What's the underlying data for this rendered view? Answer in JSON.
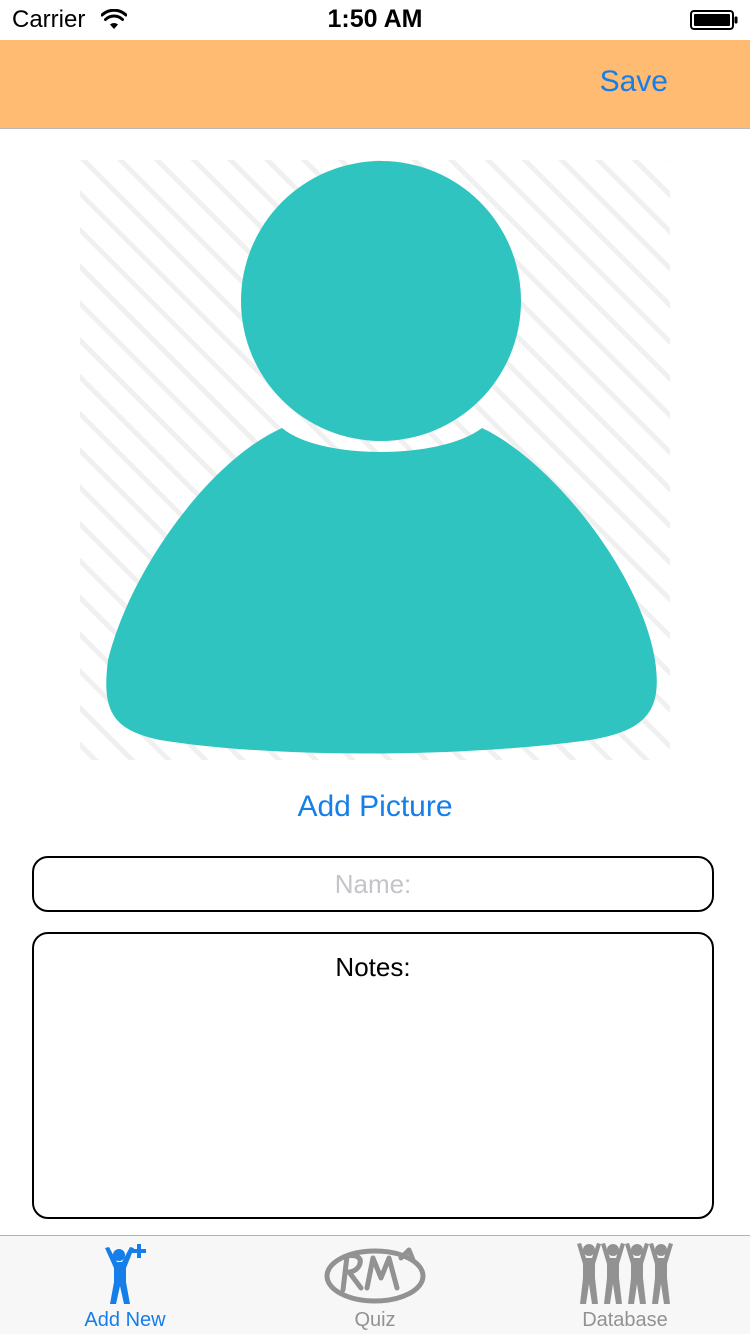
{
  "status_bar": {
    "carrier": "Carrier",
    "time": "1:50 AM"
  },
  "nav": {
    "save_label": "Save"
  },
  "colors": {
    "nav_background": "#FEBB71",
    "accent": "#157EE8",
    "avatar": "#2FC4C0",
    "tab_inactive": "#929292"
  },
  "avatar": {
    "icon": "person-placeholder-icon",
    "add_picture_label": "Add Picture"
  },
  "form": {
    "name_placeholder": "Name:",
    "name_value": "",
    "notes_label": "Notes:",
    "notes_value": ""
  },
  "tabs": [
    {
      "label": "Add New",
      "icon": "add-person-icon",
      "active": true
    },
    {
      "label": "Quiz",
      "icon": "rm-quiz-icon",
      "active": false
    },
    {
      "label": "Database",
      "icon": "people-group-icon",
      "active": false
    }
  ]
}
